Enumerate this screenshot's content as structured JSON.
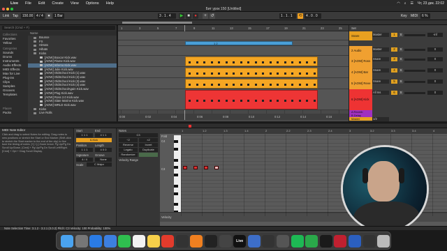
{
  "menubar": {
    "apple": "",
    "items": [
      "Live",
      "File",
      "Edit",
      "Create",
      "View",
      "Options",
      "Help"
    ],
    "clock": "Чт, 23 дек.  22:02"
  },
  "window": {
    "title": "Бит урок 150  [Untitled]"
  },
  "transport": {
    "link": "Link",
    "tap": "Tap",
    "tempo": "150.00",
    "time_sig": "4 / 4",
    "metro_label": "1 Bar",
    "position": "3 . 1 . 4",
    "loop_start": "1 . 1 . 1",
    "loop_len": "4 . 0 . 0",
    "key_label": "Key",
    "midi_label": "MIDI",
    "cpu": "6 %"
  },
  "browser": {
    "search_placeholder": "Search (Cmd + F)",
    "collections_label": "Collections",
    "places": [
      "Favorites",
      "Yellow"
    ],
    "categories_label": "Categories",
    "categories": [
      "Sounds",
      "Drums",
      "Instruments",
      "Audio Effects",
      "MIDI Effects",
      "Max for Live",
      "Plug-ins",
      "Clips",
      "Samples",
      "Grooves",
      "Templates"
    ],
    "places2_label": "Places",
    "places2": [
      "Packs"
    ],
    "column_header": "Name",
    "files": [
      {
        "name": "Bounce",
        "folder": true
      },
      {
        "name": "FX",
        "folder": true
      },
      {
        "name": "HiHats",
        "folder": true
      },
      {
        "name": "Hihats",
        "folder": true
      },
      {
        "name": "Kicks",
        "folder": true
      },
      {
        "name": "[AOW] Boxcar Kick.wav",
        "folder": false
      },
      {
        "name": "[AOW] Flame Kick.wav",
        "folder": false
      },
      {
        "name": "[AOW] Inferno Kick.wav",
        "folder": false,
        "selected": true
      },
      {
        "name": "[AOW] Julie Kick.wav",
        "folder": false
      },
      {
        "name": "[AOW] OldSchool Kick (1).wav",
        "folder": false
      },
      {
        "name": "[AOW] OldSchool Kick (2).wav",
        "folder": false
      },
      {
        "name": "[AOW] OldSchool Kick (3).wav",
        "folder": false
      },
      {
        "name": "[AOW] OldSchool Kick (4).wav",
        "folder": false
      },
      {
        "name": "[AOW] OldSchoolAgain Kick.wav",
        "folder": false
      },
      {
        "name": "[AOW] Plug Kick.wav",
        "folder": false
      },
      {
        "name": "[AOW] Ross 2.0 Kick.wav",
        "folder": false
      },
      {
        "name": "[AOW] Slate Marine Kick.wav",
        "folder": false
      },
      {
        "name": "[AOW] WRLD Kick.wav",
        "folder": false
      },
      {
        "name": "Kicks",
        "folder": true
      },
      {
        "name": "Live Rolls",
        "folder": true
      }
    ]
  },
  "arrangement": {
    "ruler_marks": [
      "1",
      "3",
      "5",
      "7",
      "9",
      "11",
      "13",
      "15",
      "17",
      "19",
      "21",
      "23",
      "25"
    ],
    "ruler_bottom": [
      "0:00",
      "0:02",
      "0:04",
      "0:06",
      "0:08",
      "0:10",
      "0:12",
      "0:14",
      "0:16"
    ],
    "clip_label_blue": "1 2",
    "tracks": [
      {
        "name": "Snare",
        "color": "#e8a020",
        "io": "Master",
        "num": "1",
        "vol": "-inf"
      },
      {
        "name": "2 Audio",
        "color": "#f0a030",
        "io": "Master",
        "num": "2",
        "vol": "0"
      },
      {
        "name": "3 [AOW] Ross",
        "color": "#f0a030",
        "io": "Snare",
        "num": "3",
        "vol": "0"
      },
      {
        "name": "4 [AOW] Bar",
        "color": "#f0a030",
        "io": "Snare",
        "num": "4",
        "vol": "0"
      },
      {
        "name": "5 [AOW] Reve",
        "color": "#f0a030",
        "io": "Snare",
        "num": "5",
        "vol": "0"
      },
      {
        "name": "6 [AOW] Kick",
        "color": "#ee3333",
        "io": "All Ins",
        "num": "6",
        "vol": "0"
      }
    ],
    "returns": [
      {
        "name": "A Reverb",
        "color": "#a030c0"
      },
      {
        "name": "B Delay",
        "color": "#a030c0"
      },
      {
        "name": "Master",
        "color": "#e8a020"
      }
    ],
    "master_io": "1/2",
    "set_label": "Set"
  },
  "midi_editor": {
    "title": "MIDI Note Editor",
    "help": "Click and drag to select Notes for editing. Drag notes to new positions or stretch the Start or End Marker (Shift-click to stretch the Start marker to the end of the clip) to fine tune the timing of notes. [+] / [-] Zoom in/out. Pg Up/Pg Dn Scroll Up/Down. [Cmd] + Pg Up/Pg Dn Scroll Left/Right. [Cmd] + Opt + Drag Scroll Display.",
    "clip_props": {
      "start_label": "Start",
      "end_label": "End",
      "start": "1 1 1",
      "end": "4 1 1",
      "clip_name": "6-Kick",
      "position_label": "Position",
      "length_label": "Length",
      "position": "1 1 1",
      "length": "4 0 0",
      "sig_label": "Signature",
      "groove_label": "Groove",
      "sig": "4 / 4",
      "groove": "None",
      "scale_label": "Scale",
      "scale": "C Major"
    },
    "notes_panel": {
      "header": "Notes",
      "pitch": "C3",
      "reverse": "Reverse",
      "invert": "Invert",
      "legato": "Legato",
      "duplicate": "Duplicate",
      "randomize": "Randomize",
      "velocity_range": "Velocity Range",
      "nudge_left": "÷2",
      "nudge_right": "×2"
    },
    "piano": {
      "fold": "Fold",
      "c4_label": "C4",
      "c3_label": "C3",
      "velocity_label": "Velocity"
    },
    "timeline_marks": [
      "1",
      "1.2",
      "1.3",
      "1.4",
      "2",
      "2.2",
      "2.3",
      "2.4",
      "3",
      "3.2",
      "3.3",
      "3.4",
      "4"
    ]
  },
  "status": {
    "text": "Note Selection    Time: 3.1.2 - 3.2.1 (0.0.2)    Pitch: C3    Velocity: 100    Probability: 100%"
  },
  "dock": {
    "apps": [
      {
        "name": "finder-icon",
        "label": "",
        "color": "#4aa3ef"
      },
      {
        "name": "launchpad-icon",
        "label": "",
        "color": "#777"
      },
      {
        "name": "safari-icon",
        "label": "",
        "color": "#2a7be4"
      },
      {
        "name": "mail-icon",
        "label": "",
        "color": "#3d7fe0"
      },
      {
        "name": "messages-icon",
        "label": "",
        "color": "#2fbf4f"
      },
      {
        "name": "photos-icon",
        "label": "",
        "color": "#f2f2f2"
      },
      {
        "name": "notes-icon",
        "label": "",
        "color": "#f7d04a"
      },
      {
        "name": "acrobat-icon",
        "label": "",
        "color": "#e23b2c"
      },
      {
        "name": "app-icon-1",
        "label": "",
        "color": "#333"
      },
      {
        "name": "flstudio-icon",
        "label": "",
        "color": "#f08020"
      },
      {
        "name": "app-icon-2",
        "label": "",
        "color": "#222"
      },
      {
        "name": "app-icon-3",
        "label": "",
        "color": "#444"
      },
      {
        "name": "live-icon",
        "label": "Live",
        "color": "#111"
      },
      {
        "name": "app-icon-4",
        "label": "",
        "color": "#3d6ec8"
      },
      {
        "name": "app-icon-5",
        "label": "",
        "color": "#333"
      },
      {
        "name": "app-icon-6",
        "label": "",
        "color": "#555"
      },
      {
        "name": "spotify-icon",
        "label": "",
        "color": "#1db954"
      },
      {
        "name": "app-icon-7",
        "label": "",
        "color": "#2aa84a"
      },
      {
        "name": "app-icon-8",
        "label": "",
        "color": "#1a1a1a"
      },
      {
        "name": "app-icon-9",
        "label": "",
        "color": "#c02030"
      },
      {
        "name": "word-icon",
        "label": "",
        "color": "#2b5fbf"
      },
      {
        "name": "app-icon-10",
        "label": "",
        "color": "#333"
      },
      {
        "name": "trash-icon",
        "label": "",
        "color": "#bbb"
      }
    ]
  },
  "colors": {
    "orange_clip": "#f5a623",
    "blue_clip": "#4a9fd8",
    "red_clip": "#ee3535",
    "selection": "#4f6e8a"
  }
}
